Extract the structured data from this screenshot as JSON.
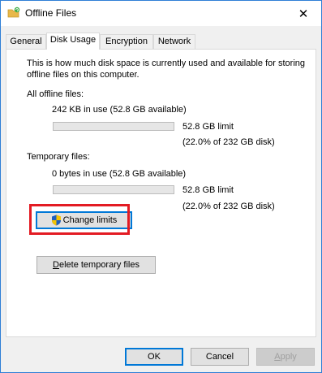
{
  "window": {
    "title": "Offline Files",
    "close_glyph": "✕"
  },
  "tabs": [
    {
      "label": "General",
      "active": false
    },
    {
      "label": "Disk Usage",
      "active": true
    },
    {
      "label": "Encryption",
      "active": false
    },
    {
      "label": "Network",
      "active": false
    }
  ],
  "disk_usage": {
    "description_line1": "This is how much disk space is currently used and available for storing",
    "description_line2": "offline files on this computer.",
    "all_offline": {
      "heading": "All offline files:",
      "usage": "242 KB in use (52.8 GB available)",
      "limit": "52.8 GB limit",
      "percent": "(22.0% of 232 GB disk)",
      "bar_fill_fraction": 0
    },
    "temporary": {
      "heading": "Temporary files:",
      "usage": "0 bytes in use (52.8 GB available)",
      "limit": "52.8 GB limit",
      "percent": "(22.0% of 232 GB disk)",
      "bar_fill_fraction": 0
    },
    "change_limits_label": "Change limits",
    "delete_temp_label_accel": "D",
    "delete_temp_label_rest": "elete temporary files"
  },
  "footer": {
    "ok_label": "OK",
    "cancel_label": "Cancel",
    "apply_label_accel": "A",
    "apply_label_rest": "pply"
  },
  "icons": {
    "app": "folder-sync-icon",
    "shield": "uac-shield-icon",
    "close": "close-icon"
  },
  "colors": {
    "highlight": "#e31b23",
    "accent": "#0078d7"
  }
}
